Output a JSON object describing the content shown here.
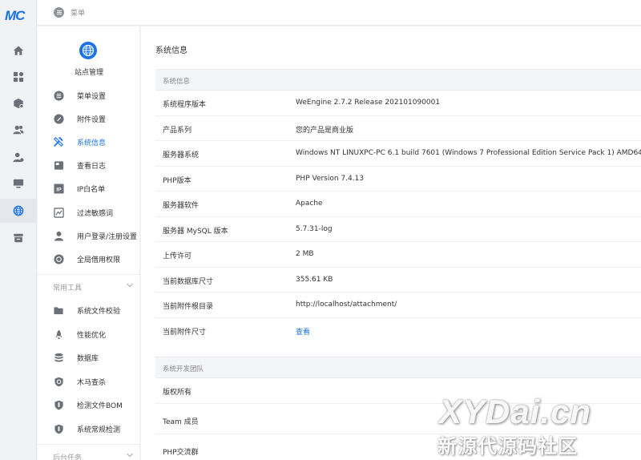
{
  "app": {
    "logo_text": "MC"
  },
  "header": {
    "breadcrumb": "菜单"
  },
  "rail": {
    "icons": [
      "home-icon",
      "apps-icon",
      "modules-icon",
      "users-icon",
      "user-manage-icon",
      "monitor-icon",
      "globe-icon",
      "store-icon"
    ],
    "active": "globe-icon"
  },
  "sidebar": {
    "site_title": "站点管理",
    "items": [
      {
        "label": "菜单设置",
        "icon": "menu-list-icon"
      },
      {
        "label": "附件设置",
        "icon": "attachment-icon"
      },
      {
        "label": "系统信息",
        "icon": "tools-icon",
        "active": true
      },
      {
        "label": "查看日志",
        "icon": "log-icon"
      },
      {
        "label": "IP白名单",
        "icon": "ip-icon"
      },
      {
        "label": "过滤敏感词",
        "icon": "filter-icon"
      },
      {
        "label": "用户登录/注册设置",
        "icon": "user-icon"
      },
      {
        "label": "全局借用权限",
        "icon": "permission-icon"
      }
    ],
    "section_tools": {
      "title": "常用工具",
      "items": [
        {
          "label": "系统文件校验",
          "icon": "folder-icon"
        },
        {
          "label": "性能优化",
          "icon": "rocket-icon"
        },
        {
          "label": "数据库",
          "icon": "database-icon"
        },
        {
          "label": "木马查杀",
          "icon": "shield-icon"
        },
        {
          "label": "检测文件BOM",
          "icon": "shield-check-icon"
        },
        {
          "label": "系统常规检测",
          "icon": "shield-scan-icon"
        }
      ]
    },
    "section_tasks": {
      "title": "后台任务"
    }
  },
  "main": {
    "page_title": "系统信息",
    "system_info": {
      "header": "系统信息",
      "rows": [
        {
          "key": "系统程序版本",
          "value": "WeEngine 2.7.2 Release 202101090001"
        },
        {
          "key": "产品系列",
          "value": "您的产品是商业版"
        },
        {
          "key": "服务器系统",
          "value": "Windows NT LINUXPC-PC 6.1 build 7601 (Windows 7 Professional Edition Service Pack 1) AMD64"
        },
        {
          "key": "PHP版本",
          "value": "PHP Version 7.4.13"
        },
        {
          "key": "服务器软件",
          "value": "Apache"
        },
        {
          "key": "服务器 MySQL 版本",
          "value": "5.7.31-log"
        },
        {
          "key": "上传许可",
          "value": "2 MB"
        },
        {
          "key": "当前数据库尺寸",
          "value": "355.61 KB"
        },
        {
          "key": "当前附件根目录",
          "value": "http://localhost/attachment/"
        },
        {
          "key": "当前附件尺寸",
          "value": "查看"
        }
      ]
    },
    "dev_team": {
      "header": "系统开发团队",
      "rows": [
        {
          "key": "版权所有"
        },
        {
          "key": "Team 成员"
        },
        {
          "key": "PHP交流群"
        }
      ]
    }
  },
  "watermark": {
    "line1": "XYDai.cn",
    "line2": "新源代源码社区"
  },
  "colors": {
    "accent": "#1a73e8",
    "icon_gray": "#6b6f76"
  }
}
